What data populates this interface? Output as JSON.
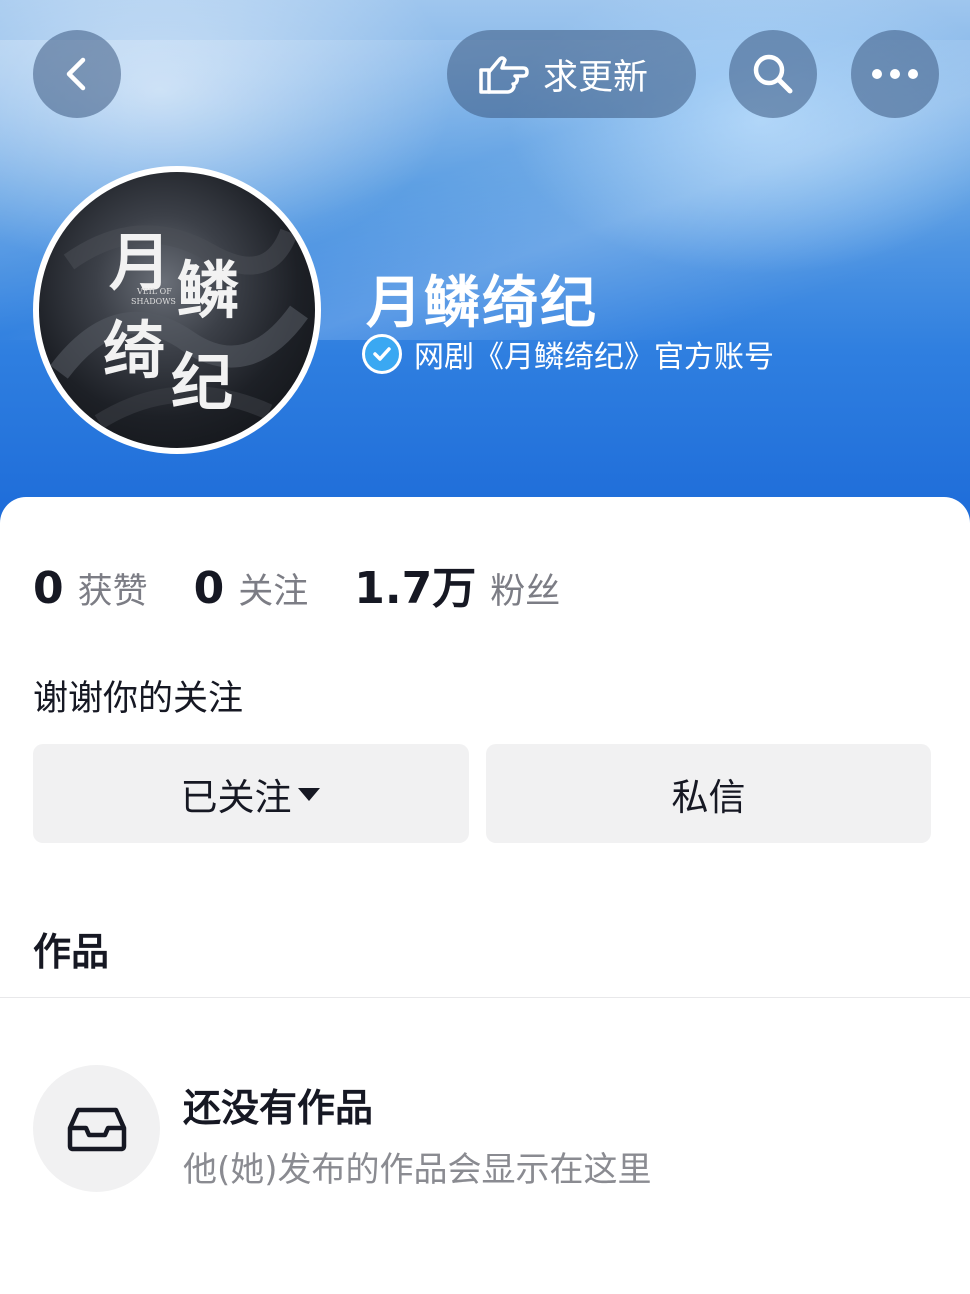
{
  "header": {
    "update_label": "求更新",
    "profile_name": "月鳞绮纪",
    "verification": "网剧《月鳞绮纪》官方账号",
    "avatar_title_text": "月鳞绮纪",
    "avatar_subtitle_text": "VEIL OF SHADOWS"
  },
  "stats": [
    {
      "value": "0",
      "label": "获赞"
    },
    {
      "value": "0",
      "label": "关注"
    },
    {
      "value": "1.7万",
      "label": "粉丝"
    }
  ],
  "bio": "谢谢你的关注",
  "actions": {
    "follow_label": "已关注",
    "message_label": "私信"
  },
  "works": {
    "title": "作品",
    "empty_title": "还没有作品",
    "empty_subtitle": "他(她)发布的作品会显示在这里"
  },
  "icons": {
    "back": "chevron-left-icon",
    "update": "pointing-hand-icon",
    "search": "search-icon",
    "more": "more-dots-icon",
    "verified": "verified-check-icon",
    "caret": "caret-down-icon",
    "empty": "inbox-tray-icon"
  },
  "colors": {
    "header_blue": "#2f7fe0",
    "verify_blue": "#3aa8f2",
    "button_gray": "#f1f1f2",
    "text_primary": "#161823",
    "text_secondary": "#7c7d85"
  }
}
